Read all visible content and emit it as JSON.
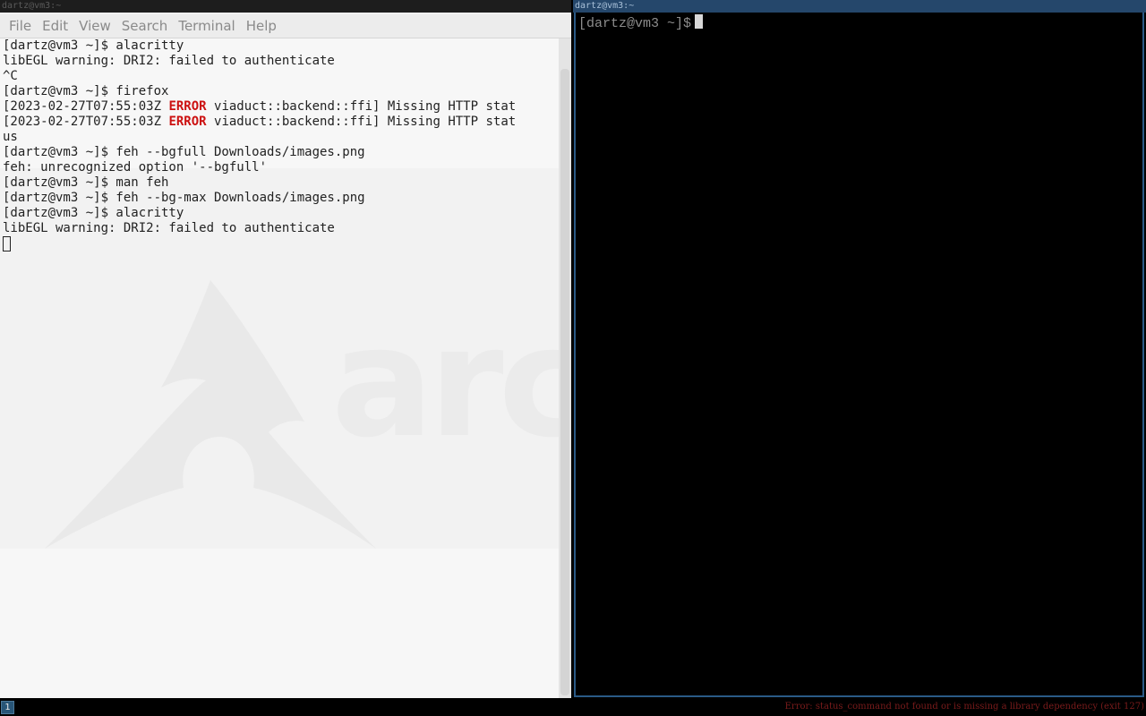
{
  "left_window": {
    "title": "dartz@vm3:~",
    "menu": [
      "File",
      "Edit",
      "View",
      "Search",
      "Terminal",
      "Help"
    ],
    "lines": [
      [
        {
          "t": "[dartz@vm3 ~]$ alacritty"
        }
      ],
      [
        {
          "t": "libEGL warning: DRI2: failed to authenticate"
        }
      ],
      [
        {
          "t": "^C"
        }
      ],
      [
        {
          "t": "[dartz@vm3 ~]$ firefox"
        }
      ],
      [
        {
          "t": "[2023-02-27T07:55:03Z "
        },
        {
          "t": "ERROR",
          "err": true
        },
        {
          "t": " viaduct::backend::ffi] Missing HTTP stat"
        }
      ],
      [
        {
          "t": "[2023-02-27T07:55:03Z "
        },
        {
          "t": "ERROR",
          "err": true
        },
        {
          "t": " viaduct::backend::ffi] Missing HTTP stat"
        }
      ],
      [
        {
          "t": "us"
        }
      ],
      [
        {
          "t": "[dartz@vm3 ~]$ feh --bgfull Downloads/images.png"
        }
      ],
      [
        {
          "t": "feh: unrecognized option '--bgfull'"
        }
      ],
      [
        {
          "t": "[dartz@vm3 ~]$ man feh"
        }
      ],
      [
        {
          "t": "[dartz@vm3 ~]$ feh --bg-max Downloads/images.png"
        }
      ],
      [
        {
          "t": "[dartz@vm3 ~]$ alacritty"
        }
      ],
      [
        {
          "t": "libEGL warning: DRI2: failed to authenticate"
        }
      ]
    ],
    "wallpaper_text": "arch"
  },
  "right_window": {
    "title": "dartz@vm3:~",
    "prompt": "[dartz@vm3 ~]$"
  },
  "bottom_bar": {
    "workspace": "1",
    "status": "Error: status_command not found or is missing a library dependency (exit 127)"
  },
  "colors": {
    "error": "#cc1111",
    "focused_border": "#2a5a86",
    "workspace_bg": "#285577"
  }
}
